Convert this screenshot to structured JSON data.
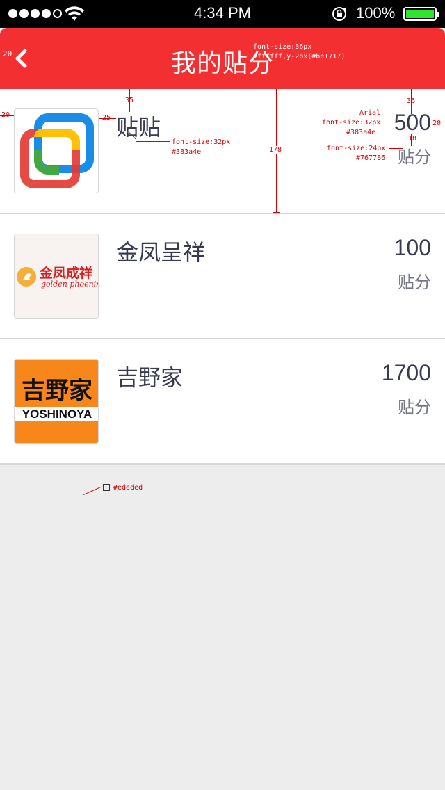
{
  "status_bar": {
    "time": "4:34 PM",
    "battery_percent": "100%",
    "battery_level": 1.0,
    "signal_bars_filled": 4,
    "signal_bars_total": 5
  },
  "nav": {
    "title": "我的贴分",
    "back_icon": "chevron-left-icon"
  },
  "items": [
    {
      "name": "贴贴",
      "points": "500",
      "unit": "贴分",
      "logo": "tietie-logo"
    },
    {
      "name": "金凤呈祥",
      "points": "100",
      "unit": "贴分",
      "logo": "golden-phoenix-logo",
      "logo_text": "金凤成祥",
      "logo_subtext": "golden phoenix"
    },
    {
      "name": "吉野家",
      "points": "1700",
      "unit": "贴分",
      "logo": "yoshinoya-logo",
      "logo_text": "吉野家",
      "logo_subtext": "YOSHINOYA"
    }
  ],
  "annotations": {
    "nav_back_size": "20",
    "title_spec_1": "font-size:36px",
    "title_spec_2": "#ffffff,y-2px(#be1717)",
    "left_margin": "20",
    "logo_gap": "25",
    "top_35": "35",
    "row_height": "178",
    "name_spec_1": "font-size:32px",
    "name_spec_2": "#383a4e",
    "top_36": "36",
    "arial": "Arial",
    "points_spec_1": "font-size:32px",
    "points_spec_2": "#383a4e",
    "gap_18": "18",
    "unit_spec_1": "font-size:24px",
    "unit_spec_2": "#767786",
    "right_margin": "20",
    "bg_color": "#ededed"
  },
  "colors": {
    "nav_bg": "#f32f32",
    "text_primary": "#383a4e",
    "text_secondary": "#767786",
    "page_bg": "#ededed",
    "annotation": "#d60000"
  }
}
